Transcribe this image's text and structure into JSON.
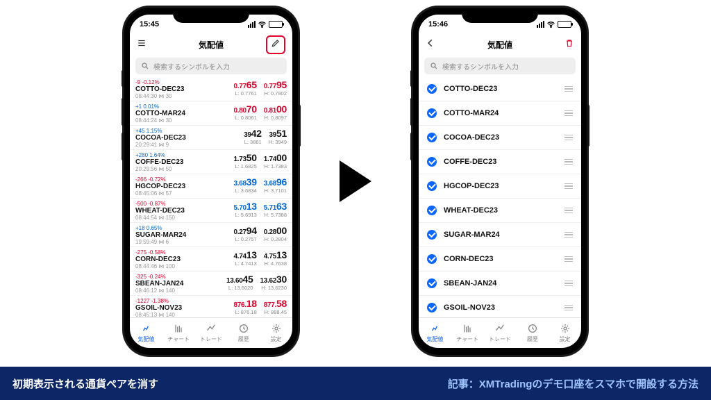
{
  "status": {
    "time_left": "15:45",
    "time_right": "15:46"
  },
  "header": {
    "title": "気配値",
    "back_aria": "back",
    "list_aria": "list-view",
    "edit_aria": "edit",
    "trash_aria": "delete"
  },
  "search": {
    "placeholder": "検索するシンボルを入力"
  },
  "symbols": [
    {
      "delta": "-9 -0.12%",
      "dir": "neg",
      "name": "COTTO-DEC23",
      "ts": "08:44:30 ⋈ 30",
      "bid_pre": "0.77",
      "bid_big": "65",
      "ask_pre": "0.77",
      "ask_big": "95",
      "low": "L: 0.7761",
      "high": "H: 0.7802",
      "pclass": "r"
    },
    {
      "delta": "+1 0.01%",
      "dir": "pos",
      "name": "COTTO-MAR24",
      "ts": "08:44:24 ⋈ 30",
      "bid_pre": "0.80",
      "bid_big": "70",
      "ask_pre": "0.81",
      "ask_big": "00",
      "low": "L: 0.8061",
      "high": "H: 0.8097",
      "pclass": "r"
    },
    {
      "delta": "+45 1.15%",
      "dir": "pos",
      "name": "COCOA-DEC23",
      "ts": "20:29:41 ⋈ 9",
      "bid_pre": "39",
      "bid_big": "42",
      "ask_pre": "39",
      "ask_big": "51",
      "low": "L: 3861",
      "high": "H: 3949",
      "pclass": "k"
    },
    {
      "delta": "+280 1.64%",
      "dir": "pos",
      "name": "COFFE-DEC23",
      "ts": "20:29:56 ⋈ 50",
      "bid_pre": "1.73",
      "bid_big": "50",
      "ask_pre": "1.74",
      "ask_big": "00",
      "low": "L: 1.6825",
      "high": "H: 1.7383",
      "pclass": "k"
    },
    {
      "delta": "-266 -0.72%",
      "dir": "neg",
      "name": "HGCOP-DEC23",
      "ts": "08:45:06 ⋈ 57",
      "bid_pre": "3.68",
      "bid_big": "39",
      "ask_pre": "3.68",
      "ask_big": "96",
      "low": "L: 3.6834",
      "high": "H: 3.7101",
      "pclass": "b"
    },
    {
      "delta": "-500 -0.87%",
      "dir": "neg",
      "name": "WHEAT-DEC23",
      "ts": "08:44:54 ⋈ 150",
      "bid_pre": "5.70",
      "bid_big": "13",
      "ask_pre": "5.71",
      "ask_big": "63",
      "low": "L: 5.6913",
      "high": "H: 5.7388",
      "pclass": "b"
    },
    {
      "delta": "+18 0.65%",
      "dir": "pos",
      "name": "SUGAR-MAR24",
      "ts": "19:59:49 ⋈ 6",
      "bid_pre": "0.27",
      "bid_big": "94",
      "ask_pre": "0.28",
      "ask_big": "00",
      "low": "L: 0.2757",
      "high": "H: 0.2804",
      "pclass": "k"
    },
    {
      "delta": "-275 -0.58%",
      "dir": "neg",
      "name": "CORN-DEC23",
      "ts": "08:44:46 ⋈ 100",
      "bid_pre": "4.74",
      "bid_big": "13",
      "ask_pre": "4.75",
      "ask_big": "13",
      "low": "L: 4.7413",
      "high": "H: 4.7638",
      "pclass": "k"
    },
    {
      "delta": "-325 -0.24%",
      "dir": "neg",
      "name": "SBEAN-JAN24",
      "ts": "08:46:12 ⋈ 140",
      "bid_pre": "13.60",
      "bid_big": "45",
      "ask_pre": "13.62",
      "ask_big": "30",
      "low": "L: 13.6020",
      "high": "H: 13.6230",
      "pclass": "k"
    },
    {
      "delta": "-1227 -1.38%",
      "dir": "neg",
      "name": "GSOIL-NOV23",
      "ts": "08:45:13 ⋈ 140",
      "bid_pre": "876.",
      "bid_big": "18",
      "ask_pre": "877.",
      "ask_big": "58",
      "low": "L: 876.18",
      "high": "H: 888.45",
      "pclass": "r"
    }
  ],
  "edit_list": [
    "COTTO-DEC23",
    "COTTO-MAR24",
    "COCOA-DEC23",
    "COFFE-DEC23",
    "HGCOP-DEC23",
    "WHEAT-DEC23",
    "SUGAR-MAR24",
    "CORN-DEC23",
    "SBEAN-JAN24",
    "GSOIL-NOV23"
  ],
  "tabs": {
    "quotes": "気配値",
    "chart": "チャート",
    "trade": "トレード",
    "history": "履歴",
    "settings": "設定"
  },
  "banner": {
    "left": "初期表示される通貨ペアを消す",
    "right": "記事：XMTradingのデモ口座をスマホで開設する方法"
  }
}
